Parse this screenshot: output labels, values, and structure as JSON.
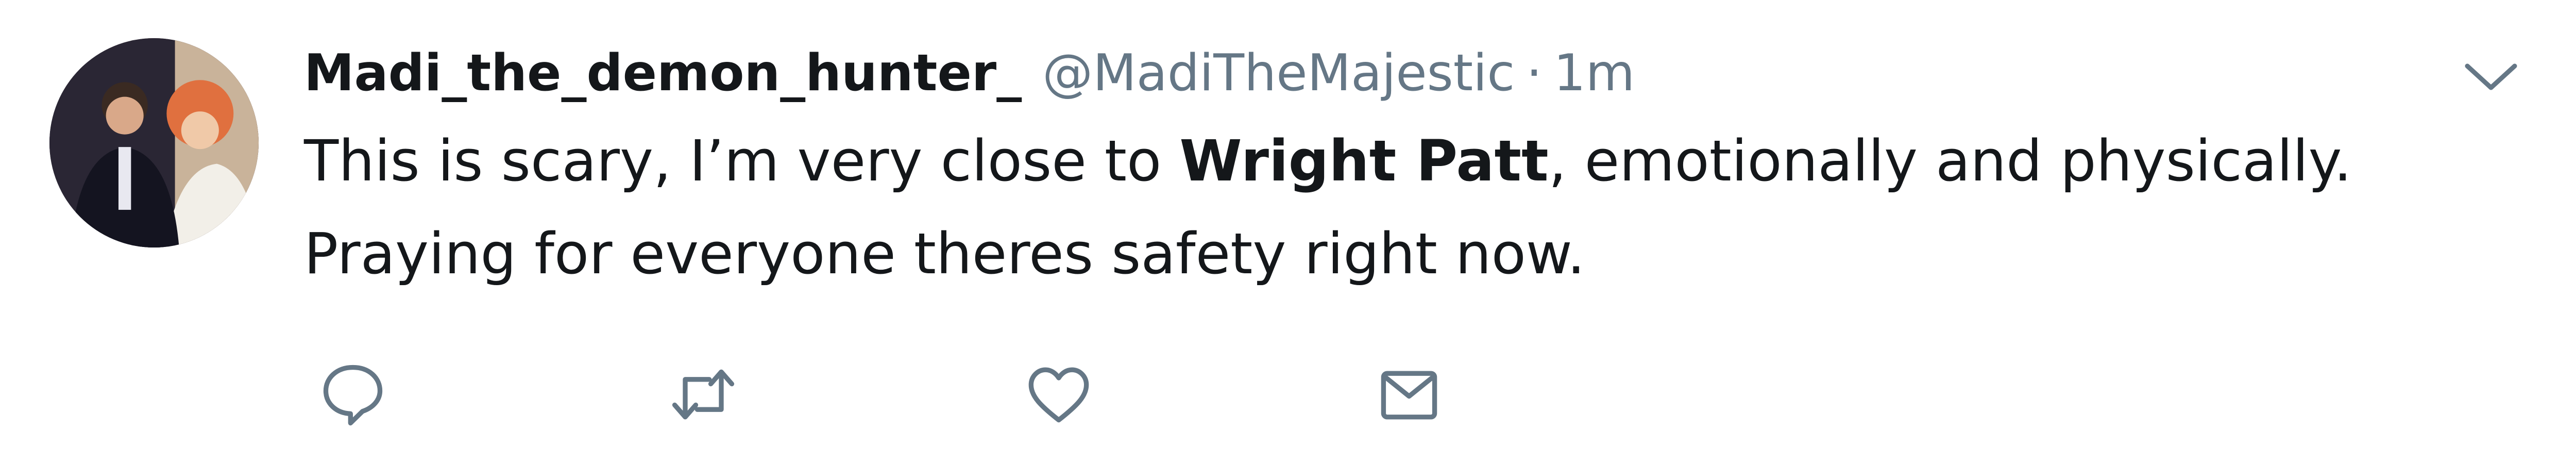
{
  "tweet": {
    "display_name": "Madi_the_demon_hunter_",
    "handle": "@MadiTheMajestic",
    "separator": "·",
    "timestamp": "1m",
    "text_before": "This is scary, I’m very close to ",
    "text_bold": "Wright Patt",
    "text_after": ", emotionally and physically. Praying for everyone theres safety right now."
  },
  "icons": {
    "menu": "chevron-down-icon",
    "reply": "reply-bubble-icon",
    "retweet": "retweet-icon",
    "like": "heart-icon",
    "dm": "envelope-icon"
  },
  "colors": {
    "text": "#14171a",
    "muted": "#657786",
    "background": "#ffffff"
  }
}
